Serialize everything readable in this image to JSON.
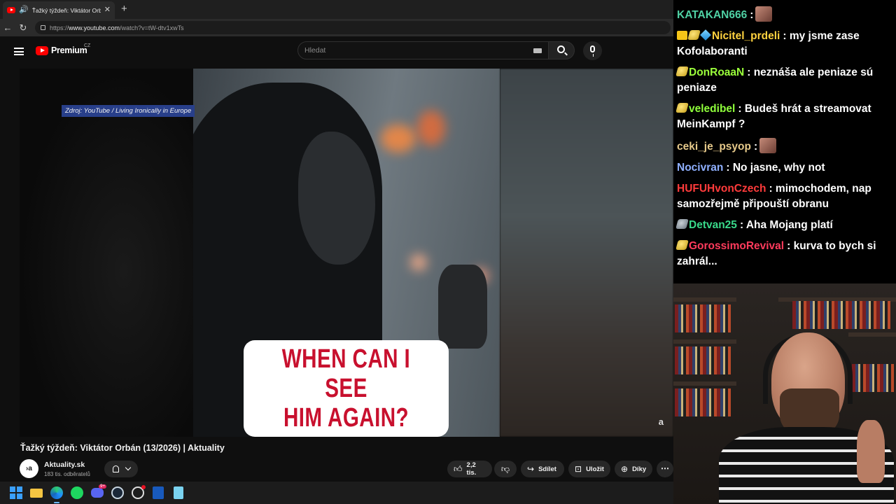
{
  "browser": {
    "tab_title": "Ťažký týždeň: Viktátor Orbán |",
    "url_prefix": "https://",
    "url_host": "www.youtube.com",
    "url_path": "/watch?v=tW-dtv1xwTs"
  },
  "youtube": {
    "logo_text": "Premium",
    "region": "CZ",
    "search_placeholder": "Hledat",
    "video": {
      "source_tag": "Zdroj: YouTube / Living Ironically in Europe",
      "caption_line1": "WHEN CAN I SEE",
      "caption_line2": "HIM AGAIN?",
      "watermark": "a",
      "title": "Ťažký týždeň: Viktátor Orbán (13/2026) | Aktuality"
    },
    "channel": {
      "avatar_text": "›a",
      "name": "Aktuality.sk",
      "subscribers": "183 tis. odběratelů"
    },
    "actions": {
      "likes": "2,2 tis.",
      "share": "Sdílet",
      "save": "Uložit",
      "thanks": "Díky"
    }
  },
  "taskbar": {
    "discord_badge": "9+"
  },
  "chat": {
    "messages": [
      {
        "user": "KATAKAN666",
        "color": "#4fd1a4",
        "text": "",
        "emote": true
      },
      {
        "user": "Nicitel_prdeli",
        "color": "#ffd23f",
        "text": "my jsme zase Kofolaboranti"
      },
      {
        "user": "DonRoaaN",
        "color": "#9bff3b",
        "text": "neznáša ale peniaze sú peniaze"
      },
      {
        "user": "veledibel",
        "color": "#8fff3b",
        "text": "Budeš hrát a streamovat MeinKampf ?"
      },
      {
        "user": "ceki_je_psyop",
        "color": "#e6c98a",
        "text": "",
        "emote": true
      },
      {
        "user": "Nocivran",
        "color": "#8fb0ff",
        "text": "No jasne, why not"
      },
      {
        "user": "HUFUHvonCzech",
        "color": "#ff3b3b",
        "text": "mimochodem, nap samozřejmě připouští obranu"
      },
      {
        "user": "Detvan25",
        "color": "#39d98a",
        "text": "Aha Mojang platí"
      },
      {
        "user": "GorossimoRevival",
        "color": "#ff3b5c",
        "text": "kurva to bych si zahrál..."
      }
    ]
  }
}
